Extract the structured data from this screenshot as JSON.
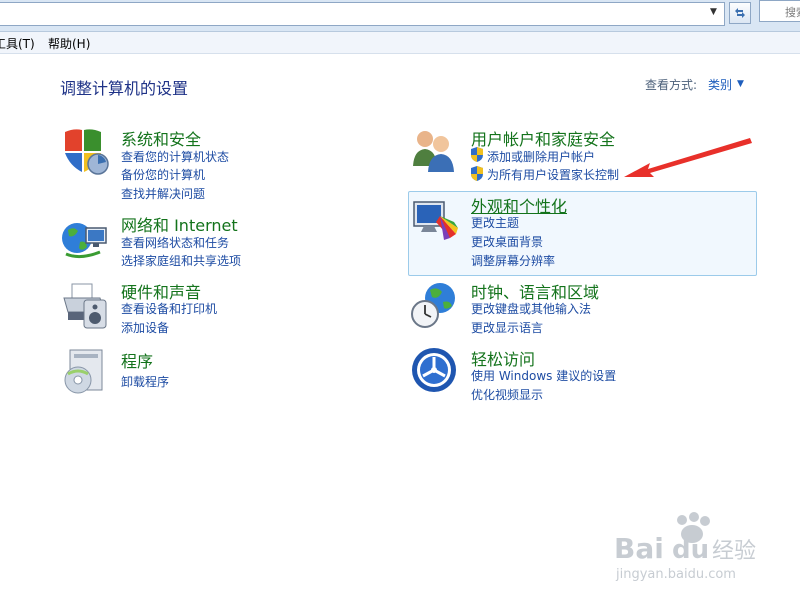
{
  "window": {
    "search_placeholder": "搜索控",
    "menu": [
      "工具(T)",
      "帮助(H)"
    ]
  },
  "header": {
    "title": "调整计算机的设置",
    "view_label": "查看方式:",
    "view_value": "类别"
  },
  "categories": [
    {
      "title": "系统和安全",
      "links": [
        "查看您的计算机状态",
        "备份您的计算机",
        "查找并解决问题"
      ],
      "icon": "shield-icon"
    },
    {
      "title": "网络和 Internet",
      "links": [
        "查看网络状态和任务",
        "选择家庭组和共享选项"
      ],
      "icon": "network-globe-icon"
    },
    {
      "title": "硬件和声音",
      "links": [
        "查看设备和打印机",
        "添加设备"
      ],
      "icon": "printer-icon"
    },
    {
      "title": "程序",
      "links": [
        "卸载程序"
      ],
      "icon": "programs-disc-icon"
    },
    {
      "title": "用户帐户和家庭安全",
      "links": [
        "添加或删除用户帐户",
        "为所有用户设置家长控制"
      ],
      "icon": "users-icon"
    },
    {
      "title": "外观和个性化",
      "links": [
        "更改主题",
        "更改桌面背景",
        "调整屏幕分辨率"
      ],
      "icon": "display-palette-icon"
    },
    {
      "title": "时钟、语言和区域",
      "links": [
        "更改键盘或其他输入法",
        "更改显示语言"
      ],
      "icon": "clock-globe-icon"
    },
    {
      "title": "轻松访问",
      "links": [
        "使用 Windows 建议的设置",
        "优化视频显示"
      ],
      "icon": "ease-of-access-icon"
    }
  ],
  "watermark": {
    "brand": "Baidu经验",
    "url": "jingyan.baidu.com"
  },
  "colors": {
    "category_title": "#13731b",
    "link": "#1e4ca3",
    "page_title": "#1e3287",
    "annotation_arrow": "#e8302a"
  }
}
